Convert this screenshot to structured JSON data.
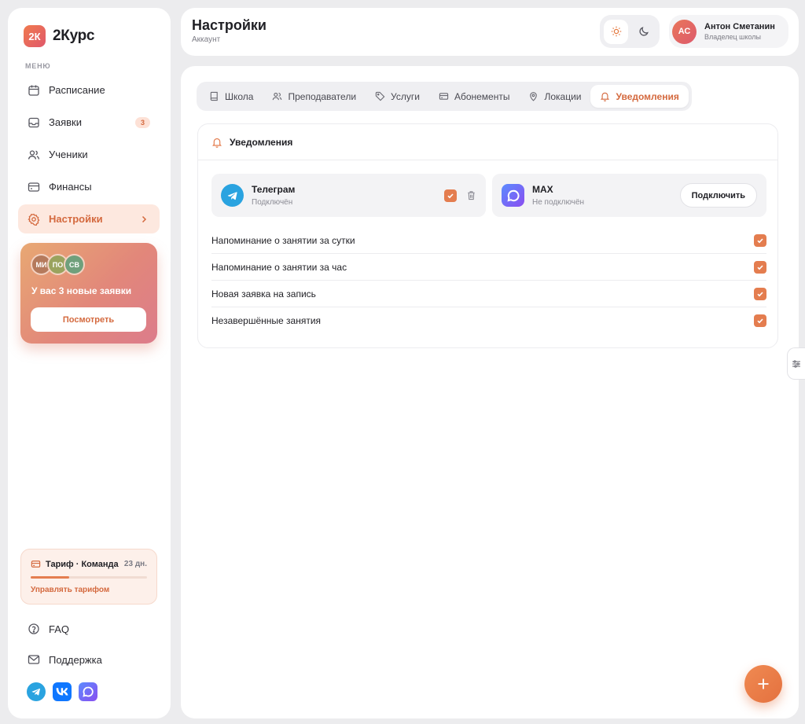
{
  "app": {
    "logo_mark": "2К",
    "name": "2Курс",
    "menu_caption": "МЕНЮ"
  },
  "colors": {
    "accent": "#e47d4f",
    "accent_text": "#d4693e",
    "active_bg": "#fde8df",
    "background": "#ececee",
    "telegram": "#2aa3e0",
    "vk": "#0f77ff"
  },
  "sidebar": {
    "items": [
      {
        "label": "Расписание",
        "icon": "calendar-icon"
      },
      {
        "label": "Заявки",
        "icon": "inbox-icon",
        "badge": "3"
      },
      {
        "label": "Ученики",
        "icon": "users-icon"
      },
      {
        "label": "Финансы",
        "icon": "wallet-icon"
      },
      {
        "label": "Настройки",
        "icon": "gear-icon",
        "active": true
      }
    ],
    "promo": {
      "avatars": [
        "МИ",
        "ПО",
        "СВ"
      ],
      "text": "У вас 3 новые заявки",
      "button": "Посмотреть"
    },
    "tariff": {
      "title": "Тариф · Команда",
      "days": "23 дн.",
      "progress": 0.33,
      "link": "Управлять тарифом"
    },
    "bottom": [
      {
        "label": "FAQ",
        "icon": "help-circle-icon"
      },
      {
        "label": "Поддержка",
        "icon": "mail-icon"
      }
    ],
    "socials": [
      "telegram-icon",
      "vk-icon",
      "max-icon"
    ]
  },
  "header": {
    "title": "Настройки",
    "subtitle": "Аккаунт",
    "theme": {
      "active": "light"
    },
    "user": {
      "initials": "АС",
      "name": "Антон Сметанин",
      "role": "Владелец школы"
    }
  },
  "tabs": [
    {
      "label": "Школа",
      "icon": "book-icon"
    },
    {
      "label": "Преподаватели",
      "icon": "users-icon"
    },
    {
      "label": "Услуги",
      "icon": "tag-icon"
    },
    {
      "label": "Абонементы",
      "icon": "card-icon"
    },
    {
      "label": "Локации",
      "icon": "map-pin-icon"
    },
    {
      "label": "Уведомления",
      "icon": "bell-icon",
      "active": true
    }
  ],
  "notifications": {
    "title": "Уведомления",
    "integrations": [
      {
        "name": "Телеграм",
        "status": "Подключён",
        "connected": true
      },
      {
        "name": "MAX",
        "status": "Не подключён",
        "connected": false,
        "button": "Подключить"
      }
    ],
    "options": [
      {
        "label": "Напоминание о занятии за сутки",
        "checked": true
      },
      {
        "label": "Напоминание о занятии за час",
        "checked": true
      },
      {
        "label": "Новая заявка на запись",
        "checked": true
      },
      {
        "label": "Незавершённые занятия",
        "checked": true
      }
    ]
  }
}
